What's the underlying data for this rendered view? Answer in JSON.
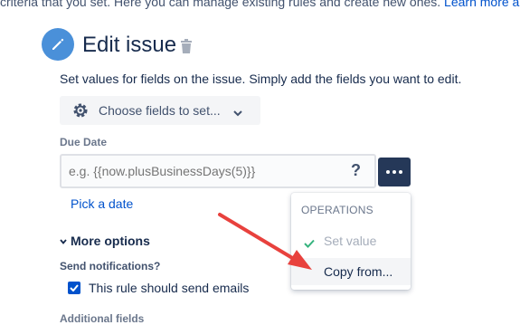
{
  "intro": {
    "text": "criteria that you set. Here you can manage existing rules and create new ones. ",
    "learn_more": "Learn more ab"
  },
  "header": {
    "title": "Edit issue",
    "icon": "pencil-icon",
    "delete_icon": "trash-icon",
    "accent": "#4a90d9"
  },
  "description": "Set values for fields on the issue. Simply add the fields you want to edit.",
  "choose_fields": {
    "label": "Choose fields to set..."
  },
  "due_date": {
    "label": "Due Date",
    "value": "",
    "placeholder": "e.g. {{now.plusBusinessDays(5)}}",
    "help": "?",
    "pick_date": "Pick a date"
  },
  "more_options": {
    "label": "More options"
  },
  "notifications": {
    "label": "Send notifications?",
    "checkbox_label": "This rule should send emails",
    "checked": true
  },
  "additional_fields": {
    "label": "Additional fields"
  },
  "operations": {
    "heading": "OPERATIONS",
    "items": [
      {
        "label": "Set value",
        "selected": true
      },
      {
        "label": "Copy from..."
      }
    ]
  },
  "colors": {
    "link": "#0052cc",
    "dark_button": "#253858",
    "annotation_arrow": "#e8413d"
  }
}
